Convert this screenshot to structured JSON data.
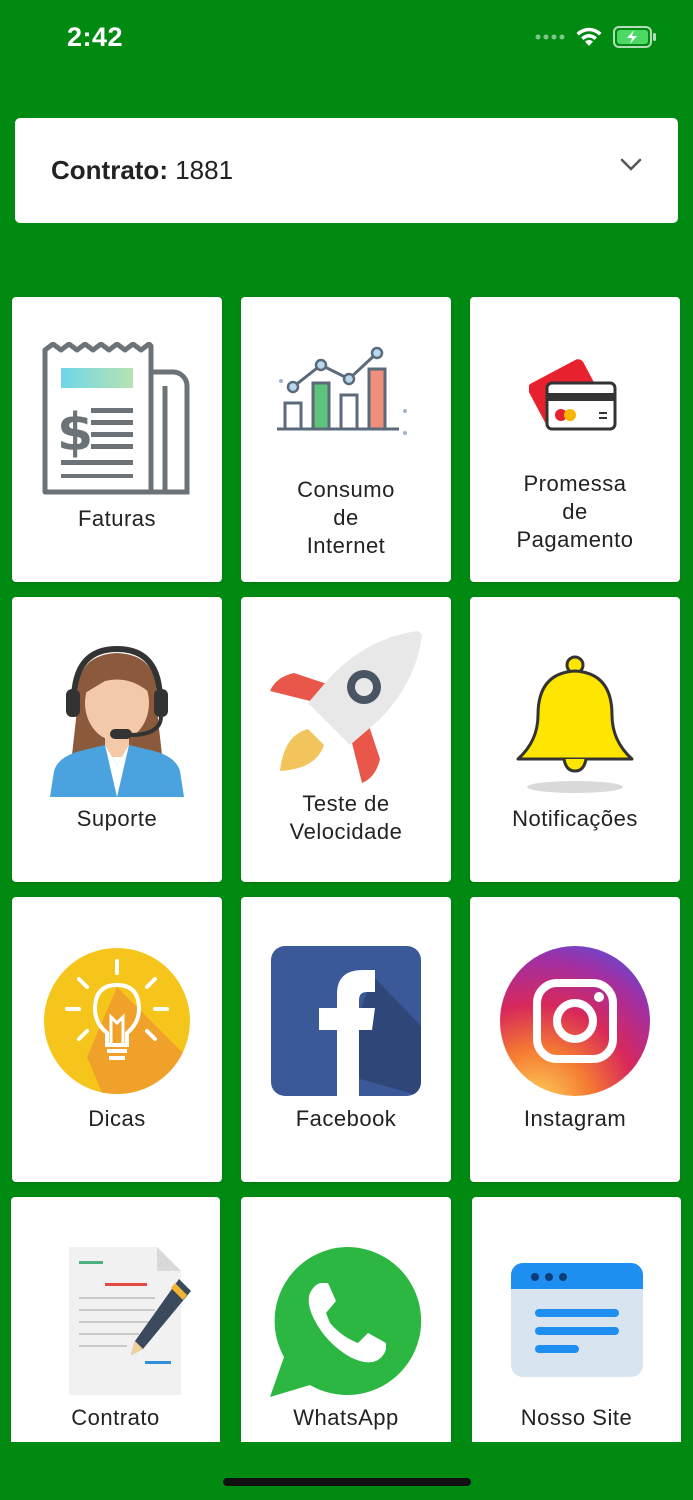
{
  "status": {
    "time": "2:42",
    "icons": [
      "signal-dots-icon",
      "wifi-icon",
      "battery-charging-icon"
    ]
  },
  "contract": {
    "label": "Contrato:",
    "value": "1881",
    "dropdown_icon": "chevron-down-icon"
  },
  "tiles": [
    {
      "label": "Faturas",
      "icon": "invoice-icon"
    },
    {
      "label": "Consumo\nde\nInternet",
      "icon": "chart-icon"
    },
    {
      "label": "Promessa\nde\nPagamento",
      "icon": "credit-card-icon"
    },
    {
      "label": "Suporte",
      "icon": "support-agent-icon"
    },
    {
      "label": "Teste de\nVelocidade",
      "icon": "rocket-icon"
    },
    {
      "label": "Notificações",
      "icon": "bell-icon"
    },
    {
      "label": "Dicas",
      "icon": "lightbulb-icon"
    },
    {
      "label": "Facebook",
      "icon": "facebook-icon"
    },
    {
      "label": "Instagram",
      "icon": "instagram-icon"
    },
    {
      "label": "Contrato",
      "icon": "document-pen-icon"
    },
    {
      "label": "WhatsApp",
      "icon": "whatsapp-icon"
    },
    {
      "label": "Nosso Site",
      "icon": "website-icon"
    }
  ],
  "colors": {
    "background": "#008a12",
    "card": "#ffffff",
    "text": "#222222"
  }
}
